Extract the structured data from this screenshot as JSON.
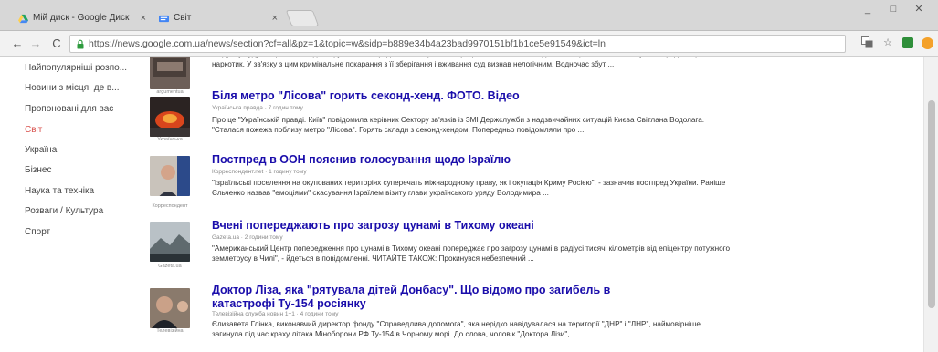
{
  "browser": {
    "tabs": [
      {
        "title": "Мій диск - Google Диск",
        "close": "×",
        "icon": "google-drive-icon"
      },
      {
        "title": "Світ",
        "close": "×",
        "icon": "google-news-icon"
      }
    ],
    "url": "https://news.google.com.ua/news/section?cf=all&pz=1&topic=w&sidp=b889e34b4a23bad9970151bf1b1ce5e91549&ict=ln",
    "nav": {
      "back": "←",
      "forward": "→",
      "reload": "C"
    },
    "window_controls": [
      "_",
      "□",
      "✕"
    ],
    "extensions": [
      "translate-icon",
      "star-icon",
      "ext-green-icon",
      "ext-orange-icon"
    ],
    "colors": {
      "link": "#1a0dab",
      "active_section": "#d9534f",
      "ext_green": "#2f8f3a",
      "ext_orange": "#f4a12a"
    }
  },
  "sidebar": {
    "items": [
      {
        "label": "Найпопулярніші розпо...",
        "active": false
      },
      {
        "label": "Новини з місця, де в...",
        "active": false
      },
      {
        "label": "Пропоновані для вас",
        "active": false
      },
      {
        "label": "Світ",
        "active": true
      },
      {
        "label": "Україна",
        "active": false
      },
      {
        "label": "Бізнес",
        "active": false
      },
      {
        "label": "Наука та техніка",
        "active": false
      },
      {
        "label": "Розваги / Культура",
        "active": false
      },
      {
        "label": "Спорт",
        "active": false
      }
    ]
  },
  "articles": [
    {
      "title": "",
      "source": "",
      "thumb_caption": "argumentua",
      "snippet": "на думку суду, якщо особа задекларувала не передбачені ... правила, продовжила неможливо довести, що її власних планувала продати цей наркотик. У зв'язку з цим кримінальне покарання з її зберігання і вживання суд визнав нелогічним. Водночас збут ..."
    },
    {
      "title": "Біля метро \"Лісова\" горить секонд-хенд. ФОТО. Відео",
      "source": "Українська правда · 7 годин тому",
      "thumb_caption": "Українська",
      "snippet": "Про це \"Українській правді. Київ\" повідомила керівник Сектору зв'язків із ЗМІ Держслужби з надзвичайних ситуацій Києва Світлана Водолага. \"Сталася пожежа поблизу метро \"Лісова\". Горять склади з секонд-хендом. Попередньо повідомляли про ..."
    },
    {
      "title": "Постпред в ООН пояснив голосування щодо Ізраїлю",
      "source": "Корреспондент.net · 1 годину тому",
      "thumb_caption": "Корреспондент",
      "snippet": "\"Ізраїльські поселення на окупованих територіях суперечать міжнародному праву, як і окупація Криму Росією\", - зазначив постпред України. Раніше Єльченко назвав \"емоціями\" скасування Ізраїлем візиту глави українського уряду Володимира ..."
    },
    {
      "title": "Вчені попереджають про загрозу цунамі в Тихому океані",
      "source": "Gazeta.ua · 2 години тому",
      "thumb_caption": "Gazeta.ua",
      "snippet": "\"Американський Центр попередження про цунамі в Тихому океані попереджає про загрозу цунамі в радіусі тисячі кілометрів від епіцентру потужного землетрусу в Чилі\", - йдеться в повідомленні. ЧИТАЙТЕ ТАКОЖ: Прокинувся небезпечний ..."
    },
    {
      "title": "Доктор Ліза, яка \"рятувала дітей Донбасу\". Що відомо про загибель в катастрофі Ту-154 росіянку",
      "source": "Телевізійна служба новин 1+1 · 4 години тому",
      "thumb_caption": "Телевізійна",
      "snippet": "Єлизавета Глінка, виконавчий директор фонду \"Справедлива допомога\", яка нерідко навідувалася на території \"ДНР\" і \"ЛНР\", наймовірніше загинула під час краху літака Міноборони РФ Ту-154 в Чорному морі. До слова, чоловік \"Доктора Лізи\", ..."
    }
  ]
}
